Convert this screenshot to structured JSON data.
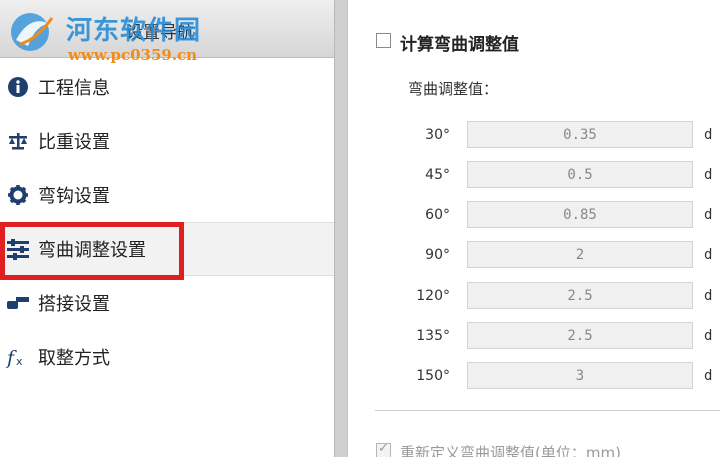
{
  "watermark": {
    "name": "河东软件园",
    "url": "www.pc0359.cn"
  },
  "sidebar": {
    "header_title": "设置导航",
    "items": [
      {
        "label": "工程信息",
        "icon": "info-icon"
      },
      {
        "label": "比重设置",
        "icon": "scale-icon"
      },
      {
        "label": "弯钩设置",
        "icon": "gear-icon"
      },
      {
        "label": "弯曲调整设置",
        "icon": "sliders-icon",
        "active": true
      },
      {
        "label": "搭接设置",
        "icon": "lap-icon"
      },
      {
        "label": "取整方式",
        "icon": "fx-icon"
      }
    ]
  },
  "panel": {
    "calc_checkbox_label": "计算弯曲调整值",
    "calc_checked": false,
    "sub_title": "弯曲调整值：",
    "rows": [
      {
        "angle": "30°",
        "value": "0.35",
        "unit": "d"
      },
      {
        "angle": "45°",
        "value": "0.5",
        "unit": "d"
      },
      {
        "angle": "60°",
        "value": "0.85",
        "unit": "d"
      },
      {
        "angle": "90°",
        "value": "2",
        "unit": "d"
      },
      {
        "angle": "120°",
        "value": "2.5",
        "unit": "d"
      },
      {
        "angle": "135°",
        "value": "2.5",
        "unit": "d"
      },
      {
        "angle": "150°",
        "value": "3",
        "unit": "d"
      }
    ],
    "redefine_label": "重新定义弯曲调整值(单位：mm)",
    "redefine_checked": true
  },
  "colors": {
    "accent_icon": "#1f3f6e",
    "highlight": "#e02020",
    "watermark_blue": "#1e88d8",
    "watermark_orange": "#f08c1c"
  }
}
